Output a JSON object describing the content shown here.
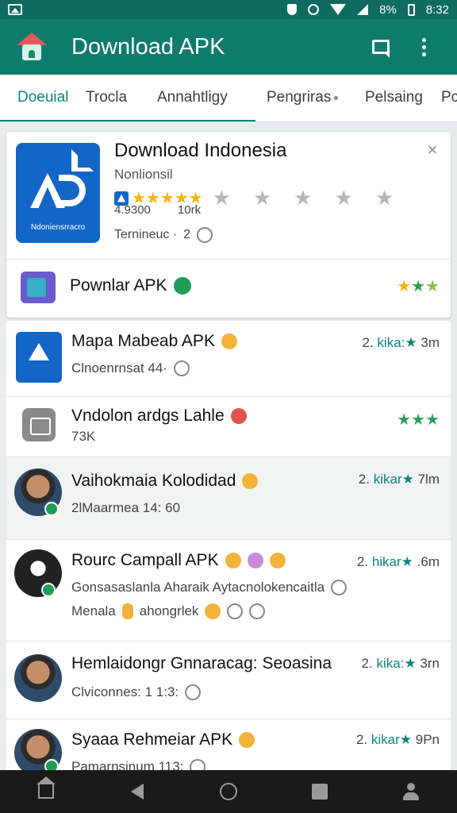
{
  "status_bar": {
    "battery": "8%",
    "time": "8:32"
  },
  "app_bar": {
    "title": "Download APK"
  },
  "tabs": [
    {
      "label": "Doeuial"
    },
    {
      "label": "Trocla"
    },
    {
      "label": "Annahtligy"
    },
    {
      "label": "Pengriras"
    },
    {
      "label": "Pelsaing"
    },
    {
      "label": "Pc"
    }
  ],
  "featured": {
    "logo_caption": "Ndoniensrracro",
    "title": "Download Indonesia",
    "subtitle": "Nonlionsil",
    "rating_gold": "★★★★★",
    "rating_grey": "★★★★★",
    "downloads": "4.9300",
    "size": "10rk",
    "meta": "Ternineuc ·",
    "meta_num": "2",
    "promo_label": "Pownlar APK",
    "promo_stars": [
      "★",
      "★",
      "★"
    ]
  },
  "list": [
    {
      "title": "Mapa Mabeab APK",
      "sub": "Clnoenrnsat 44·",
      "meta_num": "2.",
      "meta_label": "kika:",
      "meta_star": "★",
      "meta_value": "3m"
    },
    {
      "title": "Vndolon ardgs Lahle",
      "sub": "73K",
      "stars": "★★★"
    },
    {
      "title": "Vaihokmaia Kolodidad",
      "sub": "2lMaarmea 14: 60",
      "meta_num": "2.",
      "meta_label": "kikar",
      "meta_star": "★",
      "meta_value": "7lm"
    },
    {
      "title": "Rourc Campall APK",
      "sub": "Gonsasaslanla Aharaik Aytacnolokencaitla",
      "sub2": "Menala",
      "sub2b": "ahongrlek",
      "meta_num": "2.",
      "meta_label": "hikar",
      "meta_star": "★",
      "meta_value": ".6m"
    },
    {
      "title": "Hemlaidongr Gnnaracag: Seoasina",
      "sub": "Clviconnes: 1 1:3:",
      "meta_num": "2.",
      "meta_label": "kika:",
      "meta_star": "★",
      "meta_value": "3rn"
    },
    {
      "title": "Syaaa Rehmeiar APK",
      "sub": "Pamarnsinum 113:",
      "meta_num": "2.",
      "meta_label": "kikar",
      "meta_star": "★",
      "meta_value": "9Pn"
    }
  ],
  "colors": {
    "app_bar": "#0f7b6d",
    "accent": "#0c8578",
    "star_gold": "#f4b400"
  }
}
